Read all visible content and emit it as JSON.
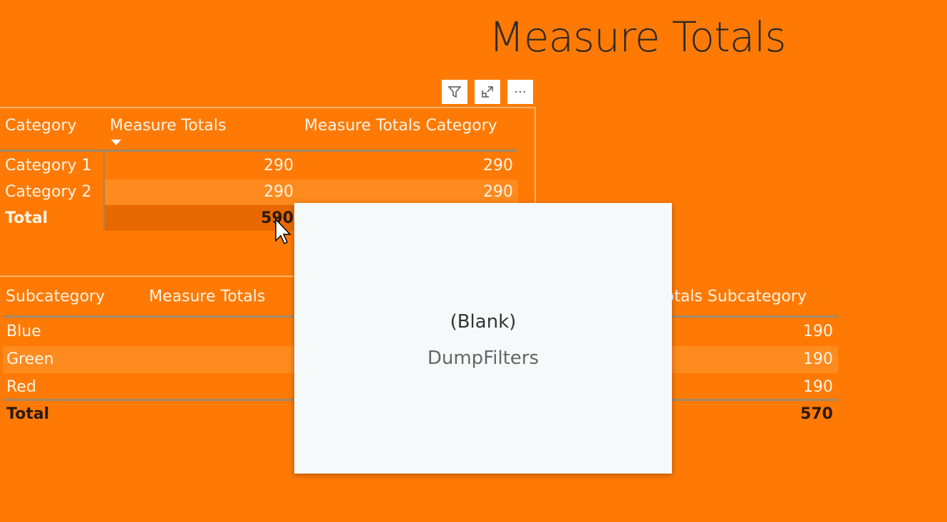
{
  "page_title": "Measure Totals",
  "toolbar": {
    "icons": [
      "filter-icon",
      "focus-mode-icon",
      "more-options-icon"
    ],
    "more": "···"
  },
  "table1": {
    "headers": [
      "Category",
      "Measure Totals",
      "Measure Totals Category"
    ],
    "rows": [
      [
        "Category 1",
        "290",
        "290"
      ],
      [
        "Category 2",
        "290",
        "290"
      ]
    ],
    "total": [
      "Total",
      "590"
    ]
  },
  "table2": {
    "headers": [
      "Subcategory",
      "Measure Totals",
      "Measure Totals Subcategory"
    ],
    "rows": [
      [
        "Blue",
        "190"
      ],
      [
        "Green",
        "190"
      ],
      [
        "Red",
        "190"
      ]
    ],
    "total": [
      "Total",
      "570"
    ]
  },
  "tooltip": {
    "value": "(Blank)",
    "label": "DumpFilters"
  },
  "colors": {
    "background": "#ff7a05",
    "tooltip": "#f5f9f9"
  }
}
